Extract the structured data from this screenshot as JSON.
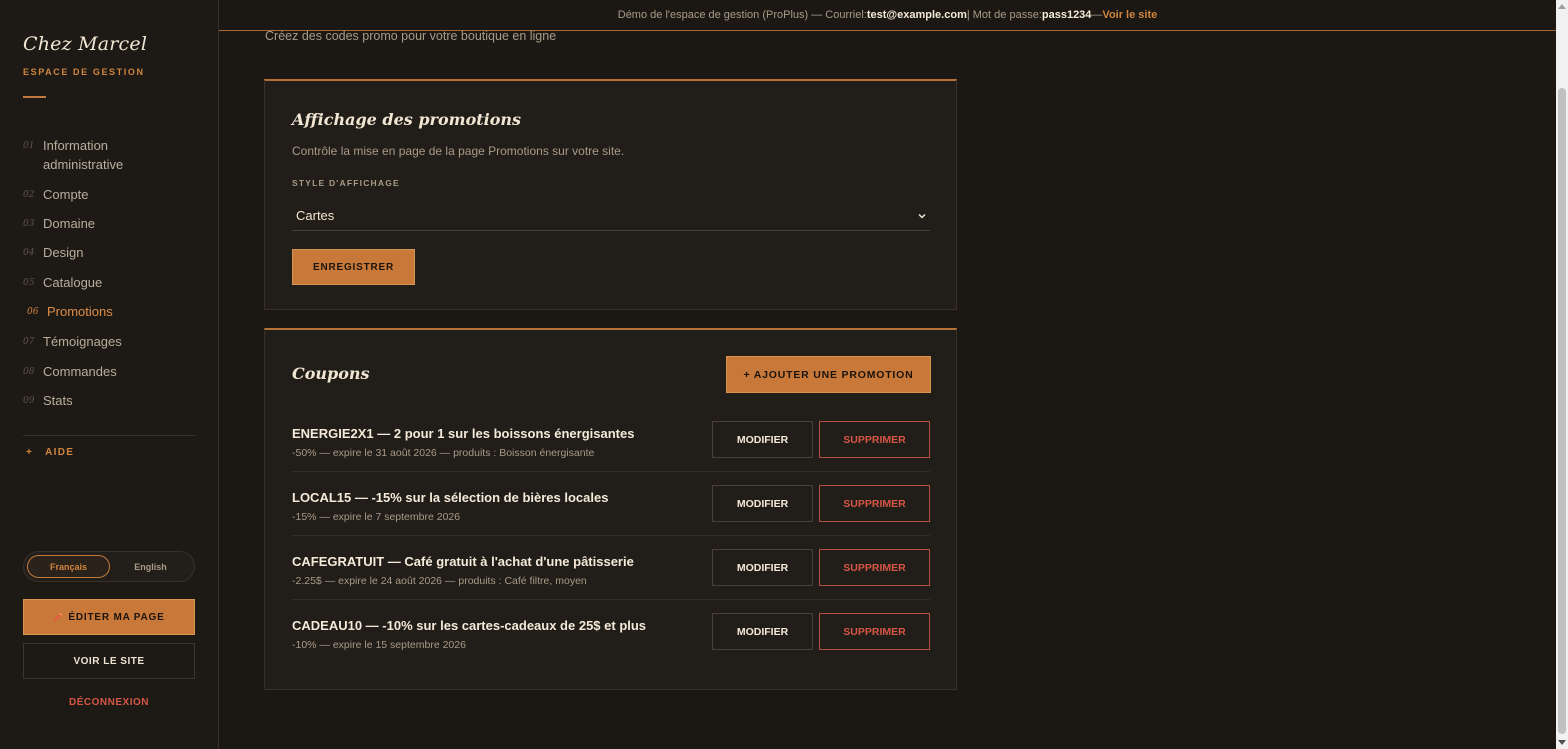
{
  "sidebar": {
    "brand": "Chez Marcel",
    "brand_sub": "ESPACE DE GESTION",
    "nav": [
      {
        "num": "01",
        "label": "Information administrative"
      },
      {
        "num": "02",
        "label": "Compte"
      },
      {
        "num": "03",
        "label": "Domaine"
      },
      {
        "num": "04",
        "label": "Design"
      },
      {
        "num": "05",
        "label": "Catalogue"
      },
      {
        "num": "06",
        "label": "Promotions",
        "active": true
      },
      {
        "num": "07",
        "label": "Témoignages"
      },
      {
        "num": "08",
        "label": "Commandes"
      },
      {
        "num": "09",
        "label": "Stats"
      }
    ],
    "help": {
      "plus": "+",
      "label": "AIDE"
    },
    "languages": {
      "fr": "Français",
      "en": "English",
      "active": "fr"
    },
    "edit_button": "ÉDITER MA PAGE",
    "edit_icon": "pencil-icon",
    "view_button": "VOIR LE SITE",
    "logout": "DÉCONNEXION"
  },
  "banner": {
    "prefix": "Démo de l'espace de gestion (ProPlus) — Courriel: ",
    "email": "test@example.com",
    "sep": " | Mot de passe: ",
    "password": "pass1234",
    "dash": " — ",
    "link": "Voir le site"
  },
  "page": {
    "subtitle": "Créez des codes promo pour votre boutique en ligne"
  },
  "display_panel": {
    "title": "Affichage des promotions",
    "description": "Contrôle la mise en page de la page Promotions sur votre site.",
    "field_label": "STYLE D'AFFICHAGE",
    "select_value": "Cartes",
    "save_button": "ENREGISTRER"
  },
  "coupons_panel": {
    "title": "Coupons",
    "add_button": "+ AJOUTER UNE PROMOTION",
    "modify_label": "MODIFIER",
    "delete_label": "SUPPRIMER",
    "items": [
      {
        "title": "ENERGIE2X1 — 2 pour 1 sur les boissons énergisantes",
        "meta": "-50% — expire le 31 août 2026 — produits : Boisson énergisante"
      },
      {
        "title": "LOCAL15 — -15% sur la sélection de bières locales",
        "meta": "-15% — expire le 7 septembre 2026"
      },
      {
        "title": "CAFEGRATUIT — Café gratuit à l'achat d'une pâtisserie",
        "meta": "-2.25$ — expire le 24 août 2026 — produits : Café filtre, moyen"
      },
      {
        "title": "CADEAU10 — -10% sur les cartes-cadeaux de 25$ et plus",
        "meta": "-10% — expire le 15 septembre 2026"
      }
    ]
  },
  "colors": {
    "accent": "#c8793a",
    "danger": "#d45745",
    "background": "#1b1814"
  }
}
